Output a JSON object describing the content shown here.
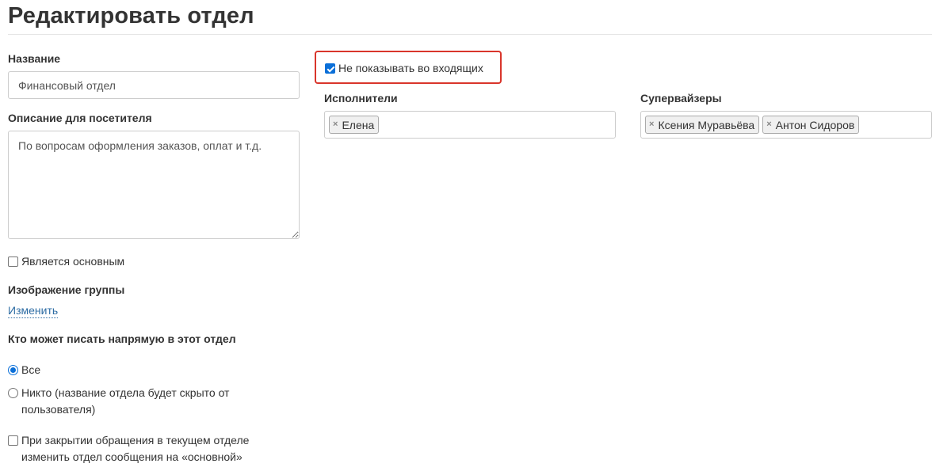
{
  "page": {
    "title": "Редактировать отдел"
  },
  "form": {
    "name_label": "Название",
    "name_value": "Финансовый отдел",
    "description_label": "Описание для посетителя",
    "description_value": "По вопросам оформления заказов, оплат и т.д.",
    "is_main_label": "Является основным",
    "is_main_checked": false,
    "image_label": "Изображение группы",
    "image_change_link": "Изменить",
    "who_can_write_label": "Кто может писать напрямую в этот отдел",
    "who_can_write_options": [
      {
        "label": "Все",
        "selected": true
      },
      {
        "label": "Никто (название отдела будет скрыто от пользователя)",
        "selected": false
      }
    ],
    "on_close_label": "При закрытии обращения в текущем отделе изменить отдел сообщения на «основной»",
    "on_close_checked": false,
    "hide_in_inbox_label": "Не показывать во входящих",
    "hide_in_inbox_checked": true,
    "performers_label": "Исполнители",
    "performers": [
      "Елена"
    ],
    "supervisors_label": "Супервайзеры",
    "supervisors": [
      "Ксения Муравьёва",
      "Антон Сидоров"
    ],
    "tag_remove_glyph": "×"
  },
  "colors": {
    "accent": "#0a6fd8",
    "link": "#2e6da4",
    "highlight": "#d9352b"
  }
}
